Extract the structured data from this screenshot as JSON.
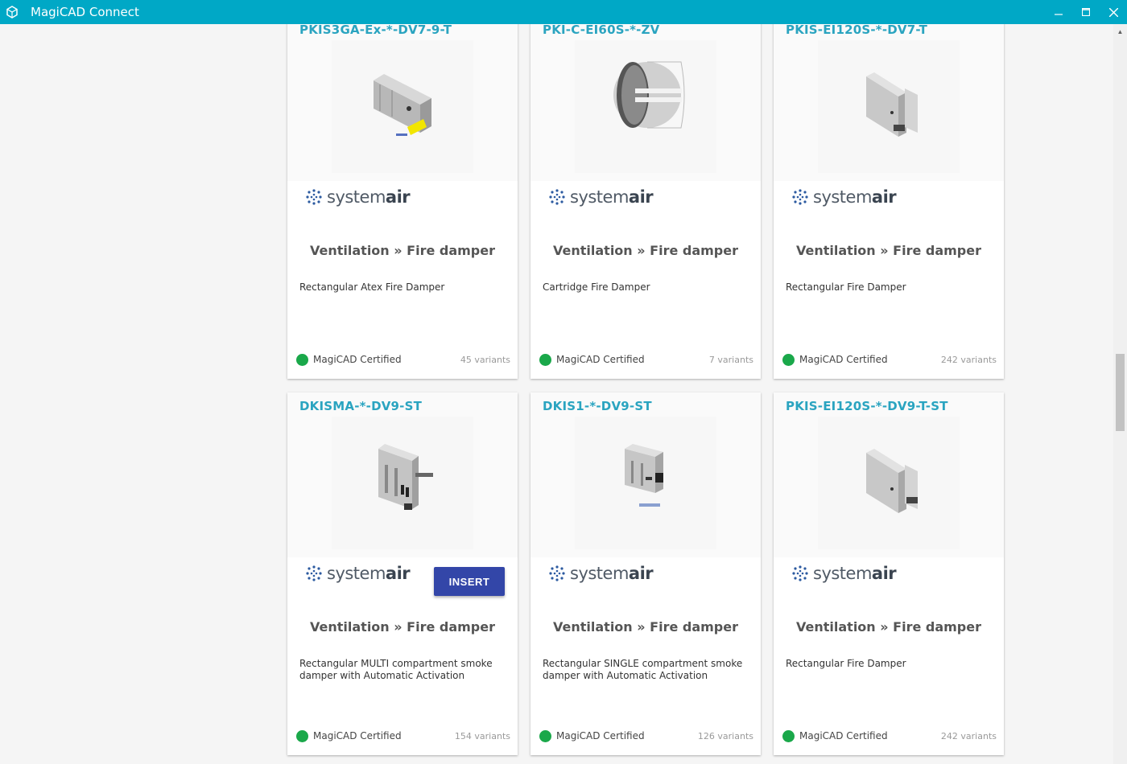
{
  "window": {
    "title": "MagiCAD Connect",
    "app_icon": "magicad-cube-icon",
    "controls": {
      "minimize": "—",
      "maximize": "☐",
      "close": "✕"
    },
    "accent_color": "#00a8c6"
  },
  "cards": [
    {
      "title": "PKIS3GA-Ex-*-DV7-9-T",
      "brand": {
        "pre": "system",
        "bold": "air"
      },
      "category": "Ventilation » Fire damper",
      "description": "Rectangular Atex Fire Damper",
      "certified_label": "MagiCAD Certified",
      "variants": "45 variants",
      "thumbnail": "rect-atex-damper-yellow-actuator"
    },
    {
      "title": "PKI-C-EI60S-*-ZV",
      "brand": {
        "pre": "system",
        "bold": "air"
      },
      "category": "Ventilation » Fire damper",
      "description": "Cartridge Fire Damper",
      "certified_label": "MagiCAD Certified",
      "variants": "7 variants",
      "thumbnail": "cartridge-round-damper"
    },
    {
      "title": "PKIS-EI120S-*-DV7-T",
      "brand": {
        "pre": "system",
        "bold": "air"
      },
      "category": "Ventilation » Fire damper",
      "description": "Rectangular Fire Damper",
      "certified_label": "MagiCAD Certified",
      "variants": "242 variants",
      "thumbnail": "rect-fire-damper"
    },
    {
      "title": "DKISMA-*-DV9-ST",
      "brand": {
        "pre": "system",
        "bold": "air"
      },
      "category": "Ventilation » Fire damper",
      "description": "Rectangular MULTI compartment smoke damper with Automatic Activation",
      "certified_label": "MagiCAD Certified",
      "variants": "154 variants",
      "thumbnail": "multi-compartment-smoke-damper",
      "insert_label": "INSERT"
    },
    {
      "title": "DKIS1-*-DV9-ST",
      "brand": {
        "pre": "system",
        "bold": "air"
      },
      "category": "Ventilation » Fire damper",
      "description": "Rectangular SINGLE compartment smoke damper with Automatic Activation",
      "certified_label": "MagiCAD Certified",
      "variants": "126 variants",
      "thumbnail": "single-compartment-smoke-damper"
    },
    {
      "title": "PKIS-EI120S-*-DV9-T-ST",
      "brand": {
        "pre": "system",
        "bold": "air"
      },
      "category": "Ventilation » Fire damper",
      "description": "Rectangular Fire Damper",
      "certified_label": "MagiCAD Certified",
      "variants": "242 variants",
      "thumbnail": "rect-fire-damper"
    }
  ],
  "colors": {
    "title_link": "#2aa4c0",
    "certified": "#1aa84a",
    "insert_button": "#3346a8"
  }
}
